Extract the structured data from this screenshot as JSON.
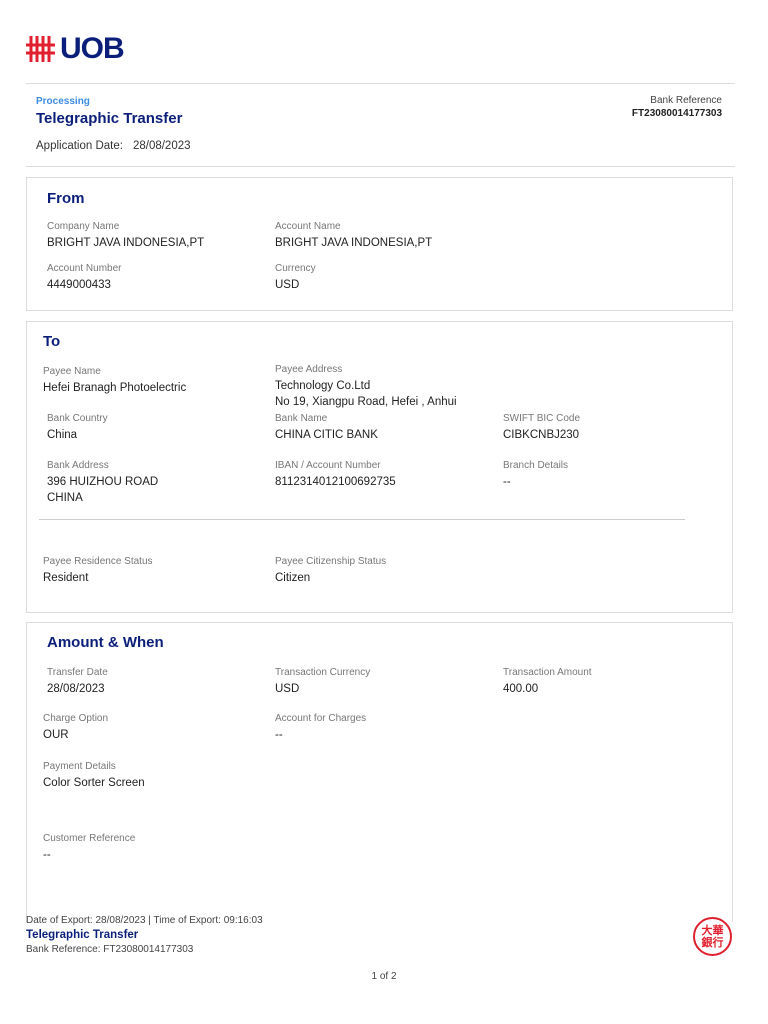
{
  "logo": {
    "text": "UOB",
    "color": "#0b1f7a",
    "accent": "#e0202e"
  },
  "header": {
    "status": "Processing",
    "title": "Telegraphic Transfer",
    "app_date_label": "Application Date:",
    "app_date": "28/08/2023",
    "bank_ref_label": "Bank Reference",
    "bank_ref": "FT23080014177303"
  },
  "from": {
    "title": "From",
    "fields": [
      {
        "label": "Company Name",
        "value": "BRIGHT JAVA INDONESIA,PT"
      },
      {
        "label": "Account Name",
        "value": "BRIGHT JAVA INDONESIA,PT"
      },
      {
        "label": "Account Number",
        "value": "4449000433"
      },
      {
        "label": "Currency",
        "value": "USD"
      }
    ]
  },
  "to": {
    "title": "To",
    "fields": [
      {
        "label": "Payee Name",
        "value": "Hefei Branagh Photoelectric"
      },
      {
        "label": "Payee Address",
        "value": "Technology Co.Ltd\nNo 19, Xiangpu Road, Hefei , Anhui"
      },
      {
        "label": "Bank Country",
        "value": "China"
      },
      {
        "label": "Bank Name",
        "value": "CHINA CITIC BANK"
      },
      {
        "label": "SWIFT BIC Code",
        "value": "CIBKCNBJ230"
      },
      {
        "label": "Bank Address",
        "value": "396 HUIZHOU ROAD\nCHINA"
      },
      {
        "label": "IBAN / Account Number",
        "value": "8112314012100692735"
      },
      {
        "label": "Branch Details",
        "value": "--"
      },
      {
        "label": "Payee Residence Status",
        "value": "Resident"
      },
      {
        "label": "Payee Citizenship Status",
        "value": "Citizen"
      }
    ]
  },
  "amount": {
    "title": "Amount & When",
    "fields": [
      {
        "label": "Transfer Date",
        "value": "28/08/2023"
      },
      {
        "label": "Transaction Currency",
        "value": "USD"
      },
      {
        "label": "Transaction Amount",
        "value": "400.00"
      },
      {
        "label": "Charge Option",
        "value": "OUR"
      },
      {
        "label": "Account for Charges",
        "value": "--"
      },
      {
        "label": "Payment Details",
        "value": "Color Sorter Screen"
      },
      {
        "label": "Customer Reference",
        "value": "--"
      }
    ]
  },
  "footer": {
    "export": "Date of Export:  28/08/2023 | Time of Export:  09:16:03",
    "title": "Telegraphic Transfer",
    "bank_ref": "Bank Reference: FT23080014177303",
    "page": "1 of 2",
    "seal_text": "大華銀行"
  }
}
